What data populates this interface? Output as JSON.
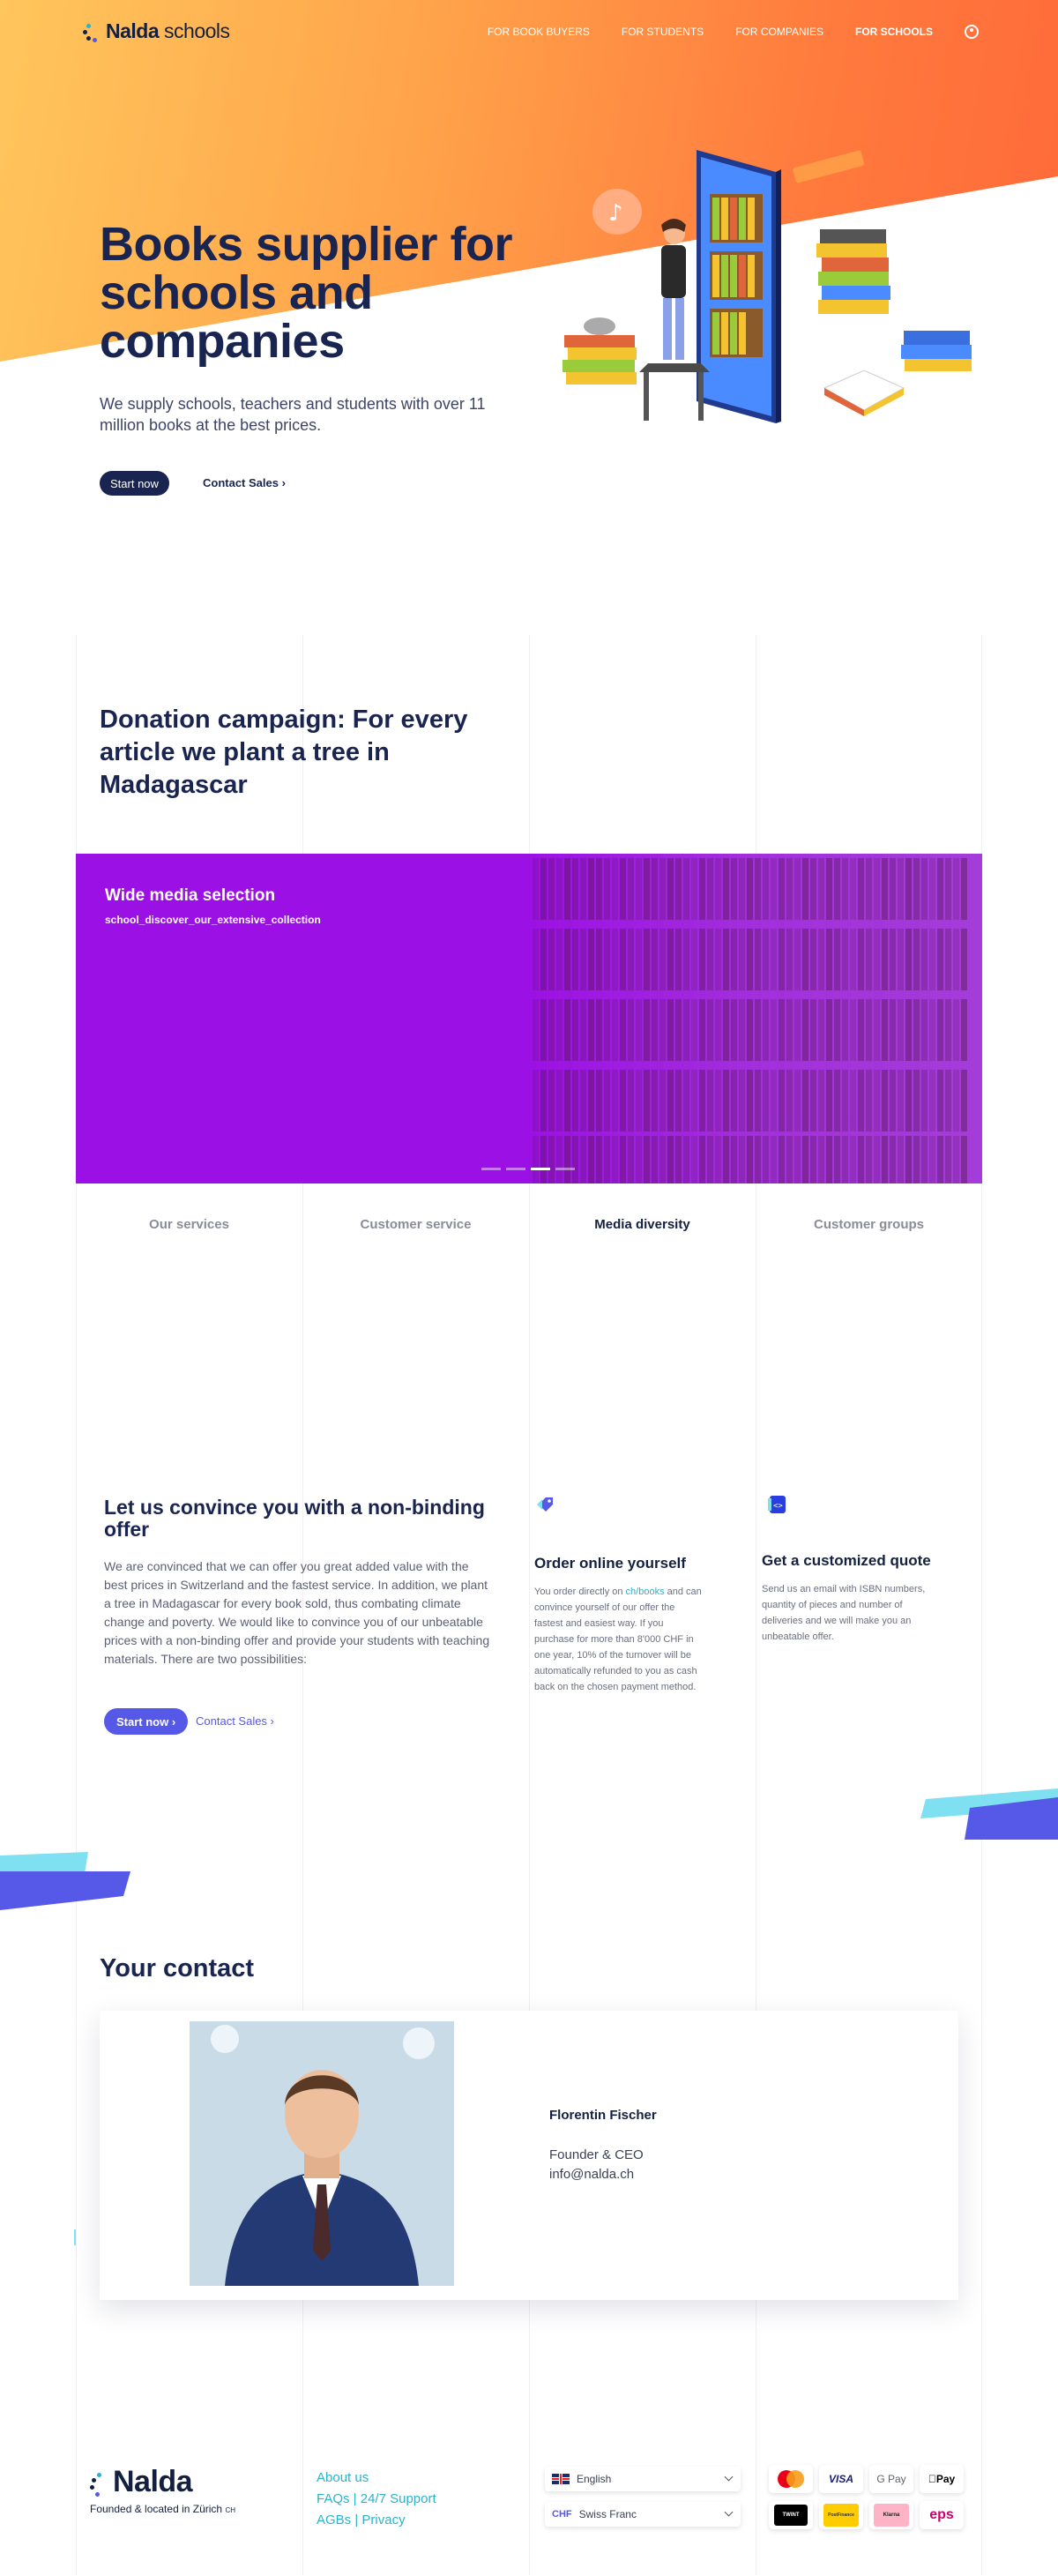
{
  "nav": {
    "brand": "Nalda",
    "brand_suffix": "schools",
    "links": [
      "FOR BOOK BUYERS",
      "FOR STUDENTS",
      "FOR COMPANIES",
      "FOR SCHOOLS"
    ],
    "active_link": "FOR SCHOOLS",
    "account_icon": "user-circle-icon"
  },
  "hero": {
    "title": "Books supplier for schools and companies",
    "subtitle": "We supply schools, teachers and students with over 11 million books at the best prices.",
    "primary_cta": "Start now",
    "secondary_cta": "Contact Sales"
  },
  "donation": {
    "title": "Donation campaign: For every article we plant a tree in Madagascar"
  },
  "banner": {
    "title": "Wide media selection",
    "subtitle": "school_discover_our_extensive_collection",
    "slides": 4,
    "active_slide": 3
  },
  "tabs": {
    "items": [
      "Our services",
      "Customer service",
      "Media diversity",
      "Customer groups"
    ],
    "active": "Media diversity"
  },
  "offer": {
    "title": "Let us convince you with a non-binding offer",
    "text": "We are convinced that we can offer you great added value with the best prices in Switzerland and the fastest service. In addition, we plant a tree in Madagascar for every book sold, thus combating climate change and poverty. We would like to convince you of our unbeatable prices with a non-binding offer and provide your students with teaching materials. There are two possibilities:",
    "primary_cta": "Start now",
    "secondary_cta": "Contact Sales"
  },
  "cards": [
    {
      "icon": "price-tag-icon",
      "title": "Order online yourself",
      "text_before": "You order directly on ",
      "link": "ch/books",
      "text_after": " and can convince yourself of our offer the fastest and easiest way. If you purchase for more than 8'000 CHF in one year, 10% of the turnover will be automatically refunded to you as cash back on the chosen payment method."
    },
    {
      "icon": "code-document-icon",
      "title": "Get a customized quote",
      "text": "Send us an email with ISBN numbers, quantity of pieces and number of deliveries and we will make you an unbeatable offer."
    }
  ],
  "contact": {
    "heading": "Your contact",
    "name": "Florentin Fischer",
    "role": "Founder & CEO",
    "email": "info@nalda.ch"
  },
  "footer": {
    "brand": "Nalda",
    "tagline": "Founded & located in Zürich",
    "tagline_badge": "CH",
    "links": [
      "About us",
      "FAQs | 24/7 Support",
      "AGBs | Privacy"
    ],
    "language": "English",
    "currency_code": "CHF",
    "currency": "Swiss Franc",
    "payment_methods": [
      "Mastercard",
      "VISA",
      "G Pay",
      "Apple Pay",
      "TWINT",
      "PostFinance",
      "Klarna",
      "eps"
    ]
  },
  "colors": {
    "navy": "#1a2450",
    "orange": "#ff7a3d",
    "purple": "#9b10e4",
    "blue_accent": "#5658e8",
    "teal_link": "#2bb3c9"
  }
}
